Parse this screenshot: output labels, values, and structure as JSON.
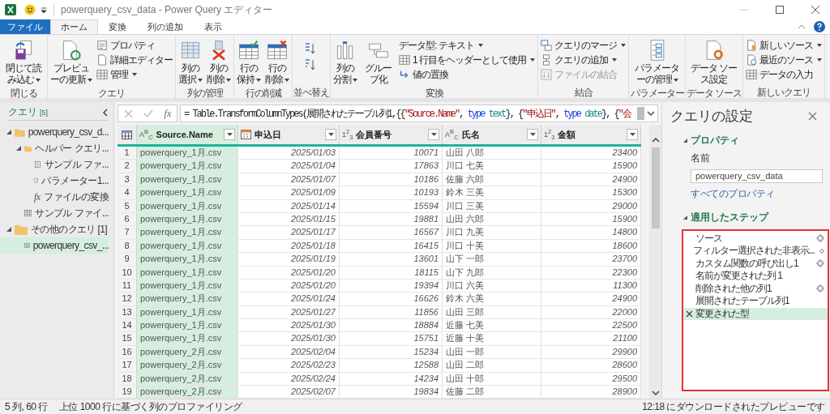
{
  "window": {
    "title": "powerquery_csv_data - Power Query エディター"
  },
  "ribbon_tabs": [
    {
      "label": "ファイル",
      "kind": "file",
      "selected": false
    },
    {
      "label": "ホーム",
      "kind": "tab",
      "selected": true
    },
    {
      "label": "変換",
      "kind": "tab",
      "selected": false
    },
    {
      "label": "列の追加",
      "kind": "tab",
      "selected": false
    },
    {
      "label": "表示",
      "kind": "tab",
      "selected": false
    }
  ],
  "ribbon_groups": [
    {
      "label": "閉じる",
      "kind": "buttons",
      "items": [
        {
          "label": "閉じて読み込む",
          "kind": "large",
          "dropdown": true,
          "disabled": false
        }
      ]
    },
    {
      "label": "クエリ",
      "kind": "buttons",
      "items": [
        {
          "label": "プレビューの更新",
          "kind": "large",
          "dropdown": true,
          "disabled": false
        },
        {
          "label": "プロパティ",
          "kind": "small",
          "dropdown": false,
          "disabled": false
        },
        {
          "label": "詳細エディター",
          "kind": "small",
          "dropdown": false,
          "disabled": false
        },
        {
          "label": "管理",
          "kind": "small",
          "dropdown": true,
          "disabled": false
        }
      ]
    },
    {
      "label": "列の管理",
      "kind": "buttons",
      "items": [
        {
          "label": "列の選択",
          "kind": "large",
          "dropdown": true,
          "disabled": false
        },
        {
          "label": "列の削除",
          "kind": "large",
          "dropdown": true,
          "disabled": false
        }
      ]
    },
    {
      "label": "行の削減",
      "kind": "buttons",
      "items": [
        {
          "label": "行の保持",
          "kind": "large",
          "dropdown": true,
          "disabled": false
        },
        {
          "label": "行の削除",
          "kind": "large",
          "dropdown": true,
          "disabled": false
        }
      ]
    },
    {
      "label": "並べ替え",
      "kind": "sort"
    },
    {
      "label": "変換",
      "kind": "buttons",
      "items": [
        {
          "label": "列の分割",
          "kind": "large",
          "dropdown": true,
          "disabled": false
        },
        {
          "label": "グループ化",
          "kind": "large",
          "dropdown": false,
          "disabled": false
        },
        {
          "label": "データ型: テキスト",
          "kind": "small",
          "dropdown": true,
          "disabled": false
        },
        {
          "label": "1 行目をヘッダーとして使用",
          "kind": "small",
          "dropdown": true,
          "disabled": false
        },
        {
          "label": "値の置換",
          "kind": "small",
          "dropdown": false,
          "disabled": false
        }
      ]
    },
    {
      "label": "結合",
      "kind": "buttons",
      "items": [
        {
          "label": "クエリのマージ",
          "kind": "small",
          "dropdown": true,
          "disabled": false
        },
        {
          "label": "クエリの追加",
          "kind": "small",
          "dropdown": true,
          "disabled": false
        },
        {
          "label": "ファイルの結合",
          "kind": "small",
          "dropdown": false,
          "disabled": true
        }
      ]
    },
    {
      "label": "パラメーター",
      "kind": "buttons",
      "items": [
        {
          "label": "パラメーターの管理",
          "kind": "large",
          "dropdown": true,
          "disabled": false
        }
      ]
    },
    {
      "label": "データ ソース",
      "kind": "buttons",
      "items": [
        {
          "label": "データ ソース設定",
          "kind": "large",
          "dropdown": false,
          "disabled": false
        }
      ]
    },
    {
      "label": "新しいクエリ",
      "kind": "buttons",
      "items": [
        {
          "label": "新しいソース",
          "kind": "small",
          "dropdown": true,
          "disabled": false
        },
        {
          "label": "最近のソース",
          "kind": "small",
          "dropdown": true,
          "disabled": false
        },
        {
          "label": "データの入力",
          "kind": "small",
          "dropdown": false,
          "disabled": false
        }
      ]
    }
  ],
  "queries": {
    "title": "クエリ",
    "count": "[5]",
    "items": [
      {
        "label": "powerquery_csv_d...",
        "kind": "folder",
        "expanded": true,
        "selected": false,
        "children": [
          {
            "label": "ヘルパー クエリ...",
            "kind": "folder",
            "expanded": true,
            "selected": false,
            "children": [
              {
                "label": "サンプル ファ...",
                "kind": "document",
                "selected": false
              },
              {
                "label": "パラメーター1...",
                "kind": "parameter",
                "selected": false
              },
              {
                "label": "ファイルの変換",
                "kind": "function",
                "glyph": "fx",
                "selected": false
              }
            ]
          },
          {
            "label": "サンプル ファイ...",
            "kind": "table",
            "selected": false
          }
        ]
      },
      {
        "label": "その他のクエリ [1]",
        "kind": "folder",
        "expanded": true,
        "selected": false,
        "children": [
          {
            "label": "powerquery_csv_...",
            "kind": "table",
            "selected": true
          }
        ]
      }
    ]
  },
  "formula_bar": {
    "fx_label": "fx",
    "formula": [
      {
        "text": "= Table.TransformColumnTypes(展開されたテーブル列1,{{",
        "kind": "plain"
      },
      {
        "text": "\"Source.Name\"",
        "kind": "string"
      },
      {
        "text": ", ",
        "kind": "plain"
      },
      {
        "text": "type ",
        "kind": "keyword"
      },
      {
        "text": "text",
        "kind": "typename"
      },
      {
        "text": "}, {",
        "kind": "plain"
      },
      {
        "text": "\"申込日\"",
        "kind": "string"
      },
      {
        "text": ", ",
        "kind": "plain"
      },
      {
        "text": "type ",
        "kind": "keyword"
      },
      {
        "text": "date",
        "kind": "typename"
      },
      {
        "text": "}, {",
        "kind": "plain"
      },
      {
        "text": "\"会",
        "kind": "string"
      }
    ]
  },
  "table": {
    "columns": [
      {
        "name": "Source.Name",
        "kind": "text",
        "type_glyph": "A$^{B}$$_{C}$",
        "selected": true
      },
      {
        "name": "申込日",
        "kind": "date",
        "selected": false
      },
      {
        "name": "会員番号",
        "kind": "number",
        "type_glyph": "1$^{2}$$_{3}$",
        "selected": false
      },
      {
        "name": "氏名",
        "kind": "text",
        "type_glyph": "A$^{B}$$_{C}$",
        "selected": false
      },
      {
        "name": "金額",
        "kind": "number",
        "type_glyph": "1$^{2}$$_{3}$",
        "selected": false
      }
    ],
    "rows": [
      {
        "n": "1",
        "cells": [
          "powerquery_1月.csv",
          "2025/01/03",
          "10071",
          "山田 八郎",
          "23400"
        ]
      },
      {
        "n": "2",
        "cells": [
          "powerquery_1月.csv",
          "2025/01/04",
          "17863",
          "川口 七美",
          "15900"
        ]
      },
      {
        "n": "3",
        "cells": [
          "powerquery_1月.csv",
          "2025/01/07",
          "10186",
          "佐藤 六郎",
          "24900"
        ]
      },
      {
        "n": "4",
        "cells": [
          "powerquery_1月.csv",
          "2025/01/09",
          "10193",
          "鈴木 三美",
          "15300"
        ]
      },
      {
        "n": "5",
        "cells": [
          "powerquery_1月.csv",
          "2025/01/14",
          "15594",
          "川口 三美",
          "29000"
        ]
      },
      {
        "n": "6",
        "cells": [
          "powerquery_1月.csv",
          "2025/01/15",
          "19881",
          "山田 六郎",
          "15900"
        ]
      },
      {
        "n": "7",
        "cells": [
          "powerquery_1月.csv",
          "2025/01/17",
          "16567",
          "川口 九美",
          "14800"
        ]
      },
      {
        "n": "8",
        "cells": [
          "powerquery_1月.csv",
          "2025/01/18",
          "16415",
          "川口 十美",
          "18600"
        ]
      },
      {
        "n": "9",
        "cells": [
          "powerquery_1月.csv",
          "2025/01/19",
          "13601",
          "山下 一郎",
          "23700"
        ]
      },
      {
        "n": "10",
        "cells": [
          "powerquery_1月.csv",
          "2025/01/20",
          "18115",
          "山下 九郎",
          "22300"
        ]
      },
      {
        "n": "11",
        "cells": [
          "powerquery_1月.csv",
          "2025/01/20",
          "19394",
          "川口 六美",
          "11300"
        ]
      },
      {
        "n": "12",
        "cells": [
          "powerquery_1月.csv",
          "2025/01/24",
          "16626",
          "鈴木 六美",
          "24900"
        ]
      },
      {
        "n": "13",
        "cells": [
          "powerquery_1月.csv",
          "2025/01/27",
          "11856",
          "山田 三郎",
          "22000"
        ]
      },
      {
        "n": "14",
        "cells": [
          "powerquery_1月.csv",
          "2025/01/30",
          "18884",
          "近藤 七美",
          "22500"
        ]
      },
      {
        "n": "15",
        "cells": [
          "powerquery_1月.csv",
          "2025/01/30",
          "15751",
          "近藤 十美",
          "21100"
        ]
      },
      {
        "n": "16",
        "cells": [
          "powerquery_2月.csv",
          "2025/02/04",
          "15234",
          "山田 一郎",
          "29900"
        ]
      },
      {
        "n": "17",
        "cells": [
          "powerquery_2月.csv",
          "2025/02/23",
          "12588",
          "山田 二郎",
          "28600"
        ]
      },
      {
        "n": "18",
        "cells": [
          "powerquery_2月.csv",
          "2025/02/24",
          "14234",
          "山田 十郎",
          "29500"
        ]
      },
      {
        "n": "19",
        "cells": [
          "powerquery_2月.csv",
          "2025/02/07",
          "19834",
          "佐藤 二郎",
          "28900"
        ]
      }
    ]
  },
  "settings": {
    "title": "クエリの設定",
    "properties_heading": "プロパティ",
    "name_label": "名前",
    "name_value": "powerquery_csv_data",
    "all_properties_link": "すべてのプロパティ",
    "steps_heading": "適用したステップ",
    "steps": [
      {
        "label": "ソース",
        "settings": true,
        "selected": false
      },
      {
        "label": "フィルター選択された非表示...",
        "settings": true,
        "selected": false
      },
      {
        "label": "カスタム関数の呼び出し1",
        "settings": true,
        "selected": false
      },
      {
        "label": "名前が変更された列 1",
        "settings": false,
        "selected": false
      },
      {
        "label": "削除された他の列1",
        "settings": true,
        "selected": false
      },
      {
        "label": "展開されたテーブル列1",
        "settings": false,
        "selected": false
      },
      {
        "label": "変更された型",
        "settings": false,
        "selected": true
      }
    ]
  },
  "status_bar": {
    "counts": "5 列, 60 行",
    "profiling": "上位 1000 行に基づく列のプロファイリング",
    "preview": "12:18 にダウンロードされたプレビューです"
  }
}
